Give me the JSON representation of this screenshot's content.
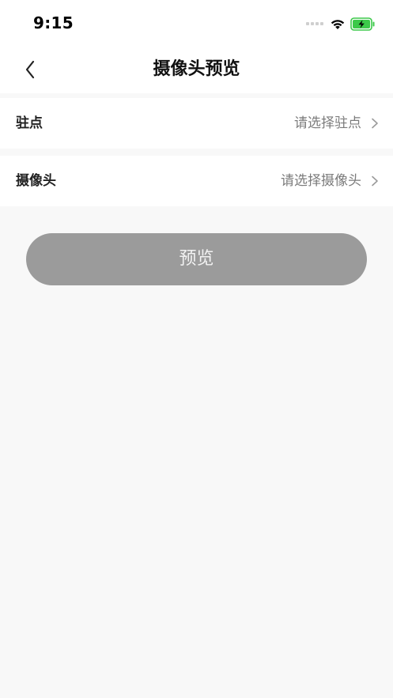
{
  "status_bar": {
    "time": "9:15",
    "signal_icon": "signal-dots-icon",
    "wifi_icon": "wifi-icon",
    "battery_icon": "battery-charging-icon",
    "battery_color": "#3cc94a"
  },
  "nav": {
    "back_icon": "chevron-left-icon",
    "title": "摄像头预览"
  },
  "form": {
    "rows": [
      {
        "label": "驻点",
        "value": "请选择驻点",
        "chevron_icon": "chevron-right-icon"
      },
      {
        "label": "摄像头",
        "value": "请选择摄像头",
        "chevron_icon": "chevron-right-icon"
      }
    ]
  },
  "actions": {
    "preview_label": "预览",
    "preview_color": "#9b9b9b"
  },
  "colors": {
    "page_background": "#f8f8f8",
    "card_background": "#ffffff",
    "placeholder_text": "#7b7b7b"
  }
}
